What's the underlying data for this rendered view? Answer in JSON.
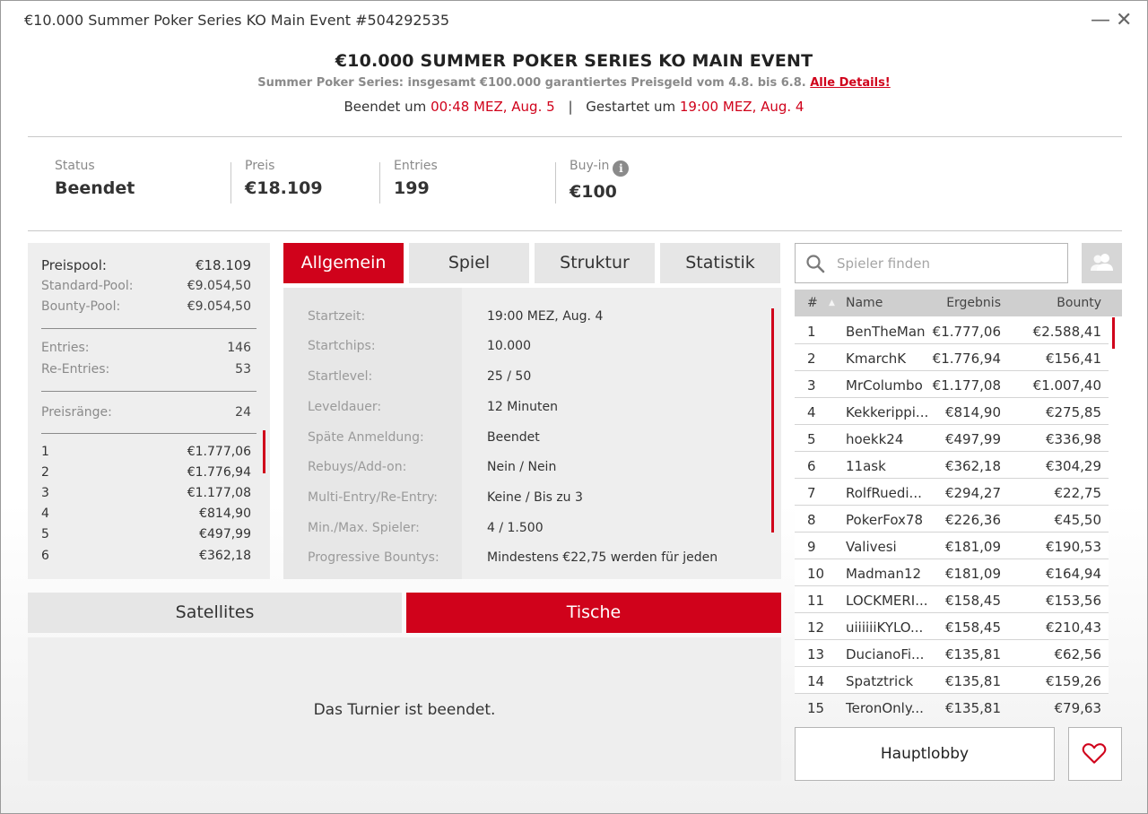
{
  "window": {
    "title": "€10.000 Summer Poker Series KO Main Event #504292535",
    "minimize": "—",
    "close": "✕"
  },
  "header": {
    "title": "€10.000 SUMMER POKER SERIES KO MAIN EVENT",
    "subtitle": "Summer Poker Series: insgesamt €100.000 garantiertes Preisgeld vom 4.8. bis 6.8.",
    "details_link": "Alle Details!",
    "ended_label": "Beendet um",
    "ended_time": "00:48 MEZ, Aug. 5",
    "separator": "|",
    "started_label": "Gestartet um",
    "started_time": "19:00 MEZ, Aug. 4"
  },
  "stats": [
    {
      "label": "Status",
      "value": "Beendet"
    },
    {
      "label": "Preis",
      "value": "€18.109"
    },
    {
      "label": "Entries",
      "value": "199"
    },
    {
      "label": "Buy-in",
      "value": "€100",
      "info_icon": "i"
    }
  ],
  "pool": {
    "preispool": {
      "label": "Preispool:",
      "value": "€18.109"
    },
    "standard": {
      "label": "Standard-Pool:",
      "value": "€9.054,50"
    },
    "bounty": {
      "label": "Bounty-Pool:",
      "value": "€9.054,50"
    },
    "entries": {
      "label": "Entries:",
      "value": "146"
    },
    "reentries": {
      "label": "Re-Entries:",
      "value": "53"
    },
    "ranks": {
      "label": "Preisränge:",
      "value": "24"
    },
    "payouts": [
      {
        "rank": "1",
        "amount": "€1.777,06"
      },
      {
        "rank": "2",
        "amount": "€1.776,94"
      },
      {
        "rank": "3",
        "amount": "€1.177,08"
      },
      {
        "rank": "4",
        "amount": "€814,90"
      },
      {
        "rank": "5",
        "amount": "€497,99"
      },
      {
        "rank": "6",
        "amount": "€362,18"
      }
    ]
  },
  "tabs": [
    "Allgemein",
    "Spiel",
    "Struktur",
    "Statistik"
  ],
  "info": [
    {
      "key": "Startzeit:",
      "value": "19:00 MEZ, Aug. 4"
    },
    {
      "key": "Startchips:",
      "value": "10.000"
    },
    {
      "key": "Startlevel:",
      "value": "25 / 50"
    },
    {
      "key": "Leveldauer:",
      "value": "12 Minuten"
    },
    {
      "key": "Späte Anmeldung:",
      "value": "Beendet"
    },
    {
      "key": "Rebuys/Add-on:",
      "value": "Nein / Nein"
    },
    {
      "key": "Multi-Entry/Re-Entry:",
      "value": "Keine / Bis zu 3"
    },
    {
      "key": "Min./Max. Spieler:",
      "value": "4 / 1.500"
    },
    {
      "key": "Progressive Bountys:",
      "value": "Mindestens €22,75 werden für jeden"
    }
  ],
  "bottom_tabs": {
    "satellites": "Satellites",
    "tische": "Tische"
  },
  "tische_message": "Das Turnier ist beendet.",
  "search": {
    "placeholder": "Spieler finden"
  },
  "table": {
    "headers": {
      "rank": "#",
      "sort": "▲",
      "name": "Name",
      "ergebnis": "Ergebnis",
      "bounty": "Bounty"
    },
    "rows": [
      {
        "rank": "1",
        "name": "BenTheMan",
        "ergebnis": "€1.777,06",
        "bounty": "€2.588,41"
      },
      {
        "rank": "2",
        "name": "KmarchK",
        "ergebnis": "€1.776,94",
        "bounty": "€156,41"
      },
      {
        "rank": "3",
        "name": "MrColumbo",
        "ergebnis": "€1.177,08",
        "bounty": "€1.007,40"
      },
      {
        "rank": "4",
        "name": "Kekkerippi...",
        "ergebnis": "€814,90",
        "bounty": "€275,85"
      },
      {
        "rank": "5",
        "name": "hoekk24",
        "ergebnis": "€497,99",
        "bounty": "€336,98"
      },
      {
        "rank": "6",
        "name": "11ask",
        "ergebnis": "€362,18",
        "bounty": "€304,29"
      },
      {
        "rank": "7",
        "name": "RolfRuedi...",
        "ergebnis": "€294,27",
        "bounty": "€22,75"
      },
      {
        "rank": "8",
        "name": "PokerFox78",
        "ergebnis": "€226,36",
        "bounty": "€45,50"
      },
      {
        "rank": "9",
        "name": "Valivesi",
        "ergebnis": "€181,09",
        "bounty": "€190,53"
      },
      {
        "rank": "10",
        "name": "Madman12",
        "ergebnis": "€181,09",
        "bounty": "€164,94"
      },
      {
        "rank": "11",
        "name": "LOCKMERI...",
        "ergebnis": "€158,45",
        "bounty": "€153,56"
      },
      {
        "rank": "12",
        "name": "uiiiiiiKYLO...",
        "ergebnis": "€158,45",
        "bounty": "€210,43"
      },
      {
        "rank": "13",
        "name": "DucianoFi...",
        "ergebnis": "€135,81",
        "bounty": "€62,56"
      },
      {
        "rank": "14",
        "name": "Spatztrick",
        "ergebnis": "€135,81",
        "bounty": "€159,26"
      },
      {
        "rank": "15",
        "name": "TeronOnly...",
        "ergebnis": "€135,81",
        "bounty": "€79,63"
      }
    ]
  },
  "lobby_button": "Hauptlobby",
  "colors": {
    "accent": "#d0021b",
    "panel": "#eeeeee",
    "muted": "#8a8a8a"
  }
}
